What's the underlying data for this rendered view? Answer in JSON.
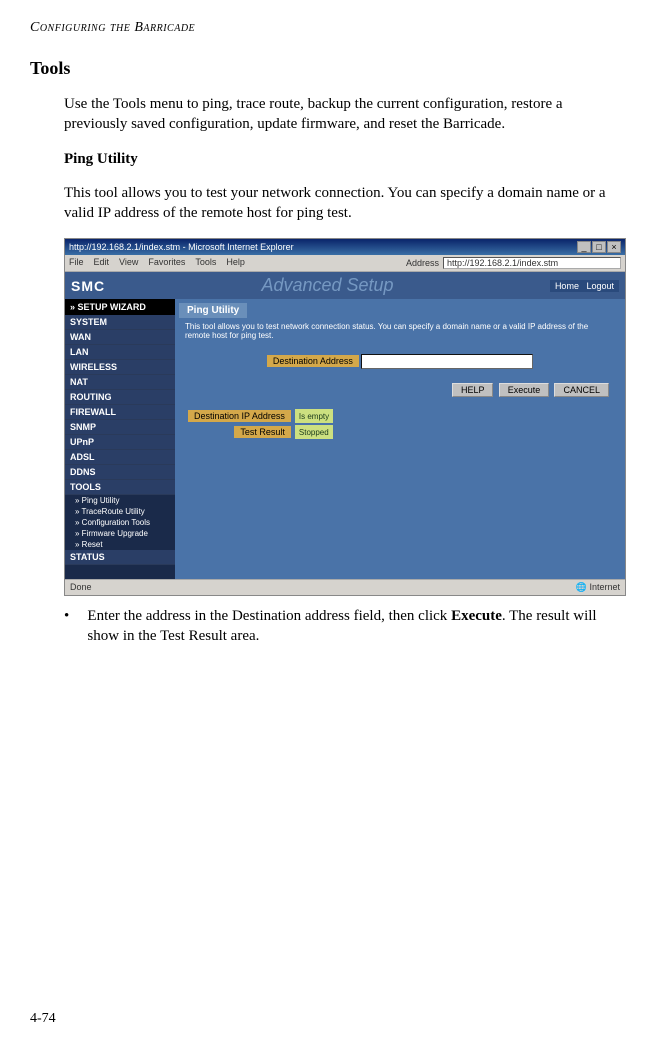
{
  "running_head": "Configuring the Barricade",
  "section_title": "Tools",
  "section_intro": "Use the Tools menu to ping, trace route, backup the current configuration, restore a previously saved configuration, update firmware, and reset the Barricade.",
  "subsection_title": "Ping Utility",
  "subsection_intro": "This tool allows you to test your network connection. You can specify a domain name or a valid IP address of the remote host for ping test.",
  "bullet_prefix": "Enter the address in the Destination address field, then click ",
  "bullet_bold": "Execute",
  "bullet_suffix": ". The result will show in the Test Result area.",
  "page_number": "4-74",
  "screenshot": {
    "window_title": "http://192.168.2.1/index.stm - Microsoft Internet Explorer",
    "menus": [
      "File",
      "Edit",
      "View",
      "Favorites",
      "Tools",
      "Help"
    ],
    "address_label": "Address",
    "address_value": "http://192.168.2.1/index.stm",
    "logo": "SMC",
    "advanced": "Advanced Setup",
    "top_links": [
      "Home",
      "Logout"
    ],
    "wizard": "» SETUP WIZARD",
    "nav": [
      "SYSTEM",
      "WAN",
      "LAN",
      "WIRELESS",
      "NAT",
      "ROUTING",
      "FIREWALL",
      "SNMP",
      "UPnP",
      "ADSL",
      "DDNS",
      "TOOLS"
    ],
    "nav_sub": [
      "» Ping Utility",
      "» TraceRoute Utility",
      "» Configuration Tools",
      "» Firmware Upgrade",
      "» Reset"
    ],
    "nav_last": "STATUS",
    "panel_title": "Ping Utility",
    "panel_desc": "This tool allows you to test network connection status. You can specify a domain name or a valid IP address of the remote host for ping test.",
    "dest_label": "Destination Address",
    "btn_help": "HELP",
    "btn_execute": "Execute",
    "btn_cancel": "CANCEL",
    "result_rows": [
      {
        "k": "Destination IP Address",
        "v": "Is empty"
      },
      {
        "k": "Test Result",
        "v": "Stopped"
      }
    ],
    "status_left": "Done",
    "status_right": "Internet"
  }
}
